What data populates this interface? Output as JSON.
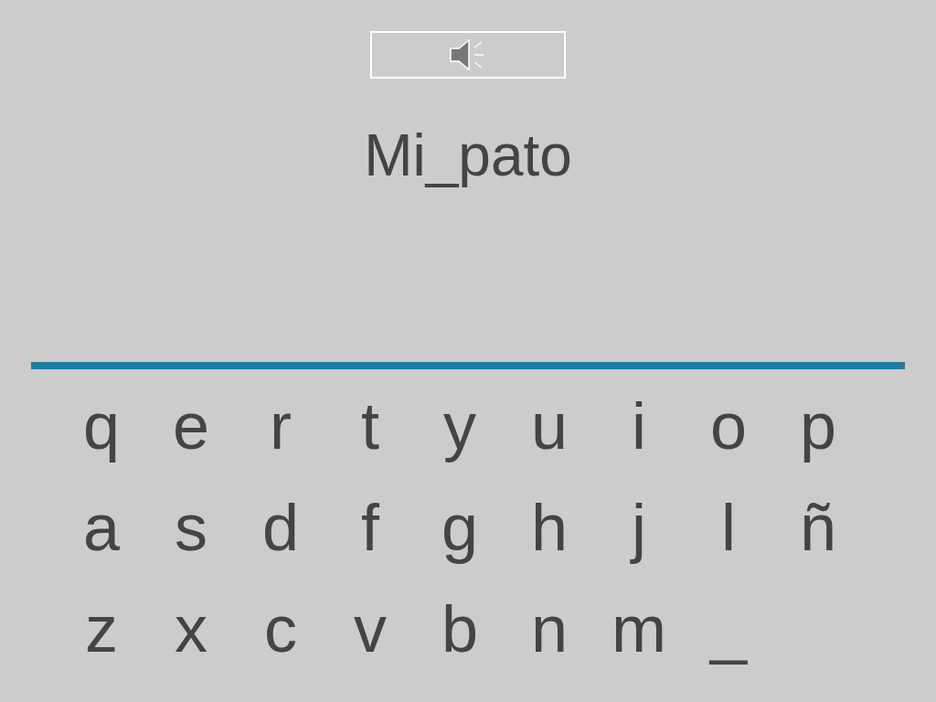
{
  "word": "Mi_pato",
  "keyboard": [
    [
      "q",
      "e",
      "r",
      "t",
      "y",
      "u",
      "i",
      "o",
      "p"
    ],
    [
      "a",
      "s",
      "d",
      "f",
      "g",
      "h",
      "j",
      "l",
      "ñ"
    ],
    [
      "z",
      "x",
      "c",
      "v",
      "b",
      "n",
      "m",
      "_"
    ]
  ]
}
